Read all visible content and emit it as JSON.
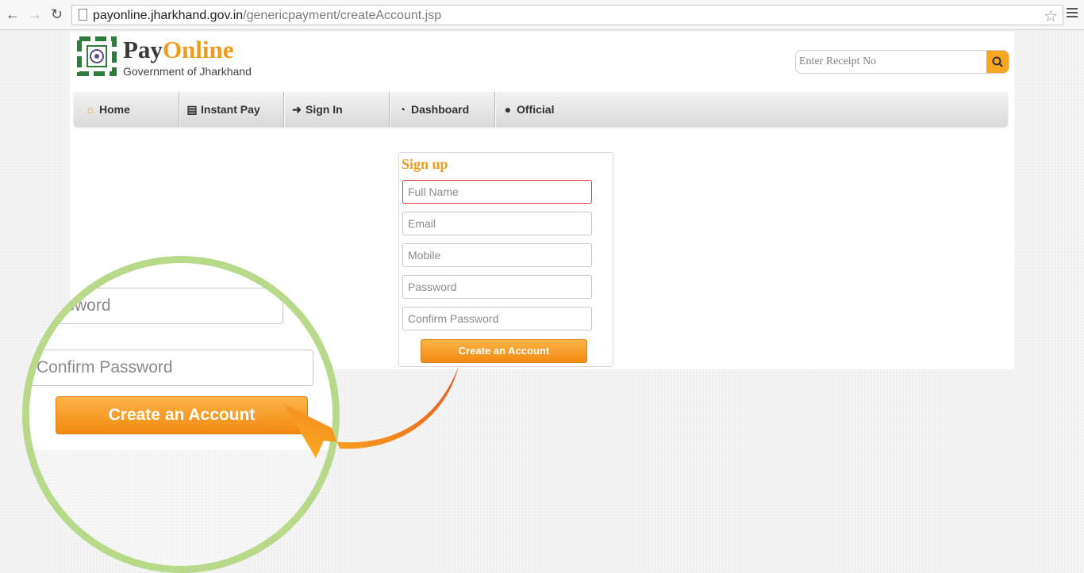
{
  "browser": {
    "url_host": "payonline.jharkhand.gov.in",
    "url_path": "/genericpayment/createAccount.jsp"
  },
  "header": {
    "brand_pay": "Pay",
    "brand_online": "Online",
    "tagline": "Government of Jharkhand",
    "search_placeholder": "Enter Receipt No"
  },
  "nav": {
    "items": [
      {
        "label": "Home",
        "icon": "home-icon"
      },
      {
        "label": "Instant Pay",
        "icon": "credit-card-icon"
      },
      {
        "label": "Sign In",
        "icon": "sign-in-icon"
      },
      {
        "label": "Dashboard",
        "icon": "dashboard-icon"
      },
      {
        "label": "Official",
        "icon": "user-icon"
      }
    ]
  },
  "signup": {
    "title": "Sign up",
    "fields": [
      {
        "placeholder": "Full Name",
        "state": "error"
      },
      {
        "placeholder": "Email"
      },
      {
        "placeholder": "Mobile"
      },
      {
        "placeholder": "Password"
      },
      {
        "placeholder": "Confirm Password"
      }
    ],
    "submit_label": "Create an Account"
  },
  "zoom": {
    "password_partial": "ssword",
    "confirm_password": "Confirm Password",
    "button_label": "Create an Account"
  },
  "colors": {
    "accent": "#f29a1c",
    "logo_green": "#2e7d3c",
    "magnifier_ring": "#b8d98a",
    "error_border": "#e23b3b"
  }
}
